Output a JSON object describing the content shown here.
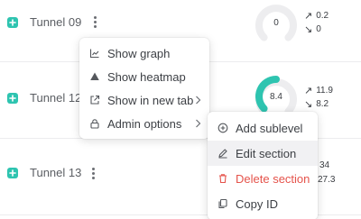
{
  "rows": [
    {
      "name": "Tunnel 09",
      "gauge": {
        "value": "0",
        "fill": 0
      },
      "up": "0.2",
      "down": "0"
    },
    {
      "name": "Tunnel 12",
      "gauge": {
        "value": "8.4",
        "fill": 0.5
      },
      "up": "11.9",
      "down": "8.2"
    },
    {
      "name": "Tunnel 13",
      "up": "34",
      "down": "27.3"
    }
  ],
  "stat_icons": {
    "up": "north-east-arrow",
    "down": "south-east-arrow"
  },
  "context_menu": {
    "items": [
      {
        "label": "Show graph",
        "icon": "line-chart-icon"
      },
      {
        "label": "Show heatmap",
        "icon": "triangle-icon"
      },
      {
        "label": "Show in new tab",
        "icon": "external-link-icon",
        "has_submenu": true
      },
      {
        "label": "Admin options",
        "icon": "lock-icon",
        "has_submenu": true
      }
    ]
  },
  "submenu": {
    "items": [
      {
        "label": "Add sublevel",
        "icon": "plus-circle-icon"
      },
      {
        "label": "Edit section",
        "icon": "pencil-icon",
        "highlighted": true
      },
      {
        "label": "Delete section",
        "icon": "trash-icon",
        "danger": true
      },
      {
        "label": "Copy ID",
        "icon": "copy-icon"
      }
    ]
  },
  "colors": {
    "accent": "#2ec4b0",
    "gauge_track": "#ededef",
    "danger": "#e5534b",
    "highlight_bg": "#f1f1f3"
  }
}
